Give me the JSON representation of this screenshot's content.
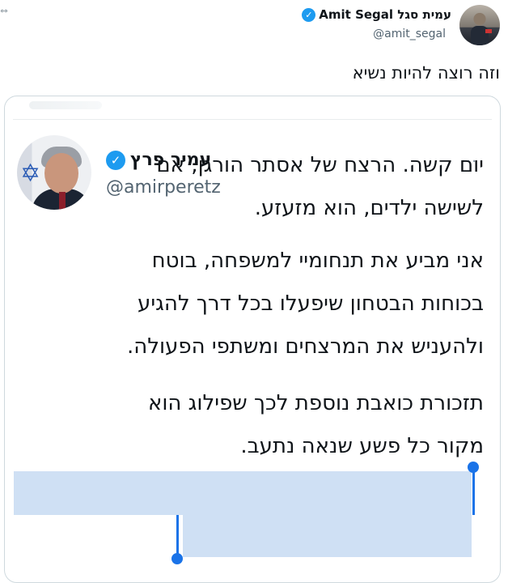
{
  "outer_tweet": {
    "more_indicator": "°°",
    "author_name": "עמית סגל Amit Segal",
    "verified_mark": "✓",
    "handle": "@amit_segal",
    "text": "וזה רוצה להיות נשיא"
  },
  "quoted_tweet": {
    "author_name": "עמיר פרץ",
    "verified_mark": "✓",
    "handle": "@amirperetz",
    "more_label": "···",
    "paragraph1": [
      "יום קשה. הרצח של אסתר הורגן, אם",
      "לשישה ילדים, הוא מזעזע."
    ],
    "paragraph2": [
      "אני מביע את תנחומיי למשפחה, בוטח",
      "בכוחות הבטחון שיפעלו בכל דרך להגיע",
      "ולהעניש את המרצחים ומשתפי הפעולה."
    ],
    "paragraph3": [
      "תזכורת כואבת נוספת לכך שפילוג הוא",
      "מקור כל פשע שנאה נתעב."
    ]
  },
  "colors": {
    "verified": "#1d9bf0",
    "selection_highlight": "#cfe0f4",
    "selection_handle": "#1a73e8"
  }
}
